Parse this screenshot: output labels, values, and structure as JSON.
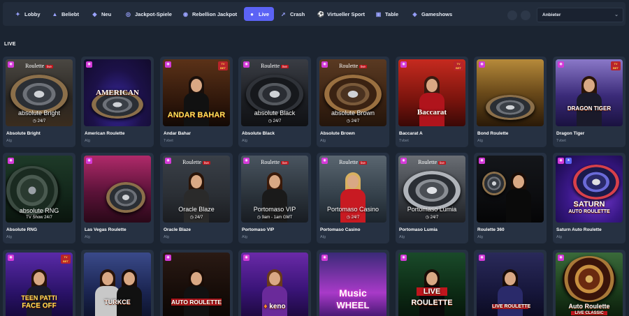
{
  "nav": {
    "items": [
      {
        "label": "Lobby",
        "icon": "rocket-icon"
      },
      {
        "label": "Beliebt",
        "icon": "flame-icon"
      },
      {
        "label": "Neu",
        "icon": "megaphone-icon"
      },
      {
        "label": "Jackpot-Spiele",
        "icon": "chip-icon"
      },
      {
        "label": "Rebellion Jackpot",
        "icon": "coin-icon"
      },
      {
        "label": "Live",
        "icon": "live-icon",
        "active": true
      },
      {
        "label": "Crash",
        "icon": "rocket-crash-icon"
      },
      {
        "label": "Virtueller Sport",
        "icon": "ball-icon"
      },
      {
        "label": "Table",
        "icon": "cards-icon"
      },
      {
        "label": "Gameshows",
        "icon": "gamepad-icon"
      }
    ],
    "provider_label": "Anbieter"
  },
  "section": {
    "title": "LIVE"
  },
  "games": [
    {
      "name": "Absolute Bright",
      "provider": "Alg",
      "thumb_brand": "Roulette",
      "thumb_title": "absolute Bright",
      "thumb_sub": "24/7"
    },
    {
      "name": "American Roulette",
      "provider": "Alg",
      "thumb_banner": "AMERICAN"
    },
    {
      "name": "Andar Bahar",
      "provider": "Tvbet",
      "thumb_banner": "ANDAR BAHAR"
    },
    {
      "name": "Absolute Black",
      "provider": "Alg",
      "thumb_brand": "Roulette",
      "thumb_title": "absolute Black",
      "thumb_sub": "24/7"
    },
    {
      "name": "Absolute Brown",
      "provider": "Alg",
      "thumb_brand": "Roulette",
      "thumb_title": "absolute Brown",
      "thumb_sub": "24/7"
    },
    {
      "name": "Baccarat A",
      "provider": "Tvbet",
      "thumb_banner": "Baccarat"
    },
    {
      "name": "Bond Roulette",
      "provider": "Alg"
    },
    {
      "name": "Dragon Tiger",
      "provider": "Tvbet",
      "thumb_banner": "DRAGON TIGER"
    },
    {
      "name": "Absolute RNG",
      "provider": "Alg",
      "thumb_title": "absolute RNG",
      "thumb_sub": "TV Show 24/7"
    },
    {
      "name": "Las Vegas Roulette",
      "provider": "Alg"
    },
    {
      "name": "Oracle Blaze",
      "provider": "Alg",
      "thumb_brand": "Roulette",
      "thumb_title": "Oracle Blaze",
      "thumb_sub": "24/7"
    },
    {
      "name": "Portomaso VIP",
      "provider": "Alg",
      "thumb_brand": "Roulette",
      "thumb_title": "Portomaso VIP",
      "thumb_sub": "9am - 1am GMT"
    },
    {
      "name": "Portomaso Casino",
      "provider": "Alg",
      "thumb_brand": "Roulette",
      "thumb_title": "Portomaso Casino",
      "thumb_sub": "24/7"
    },
    {
      "name": "Portomaso Lumia",
      "provider": "Alg",
      "thumb_brand": "Roulette",
      "thumb_title": "Portomaso Lumia",
      "thumb_sub": "24/7"
    },
    {
      "name": "Roulette 360",
      "provider": "Alg"
    },
    {
      "name": "Saturn Auto Roulette",
      "provider": "Alg",
      "thumb_banner": "SATURN",
      "thumb_banner2": "AUTO ROULETTE"
    },
    {
      "name": "",
      "provider": "",
      "thumb_banner": "TEEN PATTI",
      "thumb_banner2": "FACE OFF"
    },
    {
      "name": "",
      "provider": "",
      "thumb_banner": "TURKCE"
    },
    {
      "name": "",
      "provider": "",
      "thumb_banner": "AUTO ROULETTE"
    },
    {
      "name": "",
      "provider": "",
      "thumb_banner": "keno"
    },
    {
      "name": "",
      "provider": "",
      "thumb_banner": "Music",
      "thumb_banner2": "WHEEL"
    },
    {
      "name": "",
      "provider": "",
      "thumb_banner": "LIVE",
      "thumb_banner2": "ROULETTE"
    },
    {
      "name": "",
      "provider": "",
      "thumb_banner": "LIVE ROULETTE"
    },
    {
      "name": "",
      "provider": "",
      "thumb_banner": "Auto Roulette",
      "thumb_banner2": "LIVE CLASSIC"
    }
  ]
}
